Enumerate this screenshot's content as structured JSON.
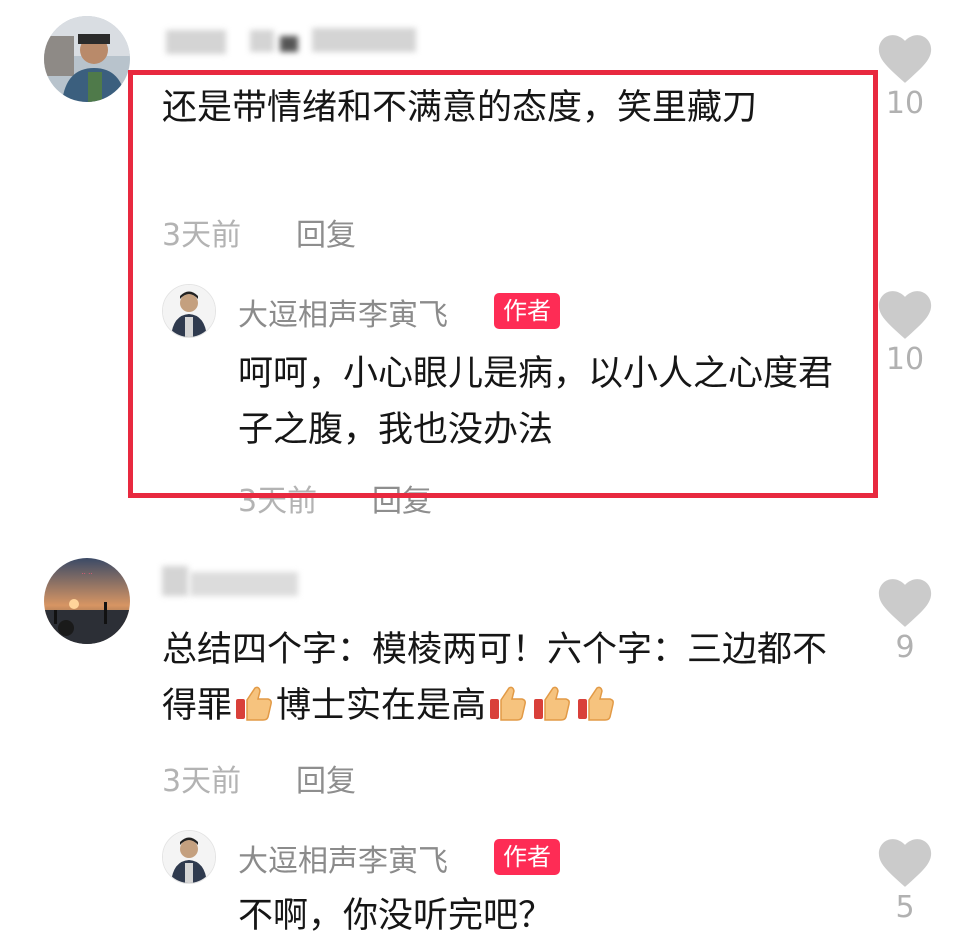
{
  "comments": [
    {
      "username": "",
      "text": "还是带情绪和不满意的态度，笑里藏刀",
      "time": "3天前",
      "reply_label": "回复",
      "likes": "10",
      "reply": {
        "author": "大逗相声李寅飞",
        "badge": "作者",
        "text": "呵呵，小心眼儿是病，以小人之心度君子之腹，我也没办法",
        "time": "3天前",
        "reply_label": "回复",
        "likes": "10"
      }
    },
    {
      "username": "",
      "text_part1": "总结四个字：模棱两可！六个字：三边都不得罪",
      "text_part2": "博士实在是高",
      "time": "3天前",
      "reply_label": "回复",
      "likes": "9",
      "reply": {
        "author": "大逗相声李寅飞",
        "badge": "作者",
        "text": "不啊，你没听完吧？",
        "likes": "5"
      }
    }
  ],
  "icons": {
    "like": "heart-icon",
    "emoji": "thumbs-up-icon"
  },
  "colors": {
    "badge": "#fe2c55",
    "highlight_box": "#e8293f",
    "like_icon": "#cbcbcb"
  }
}
